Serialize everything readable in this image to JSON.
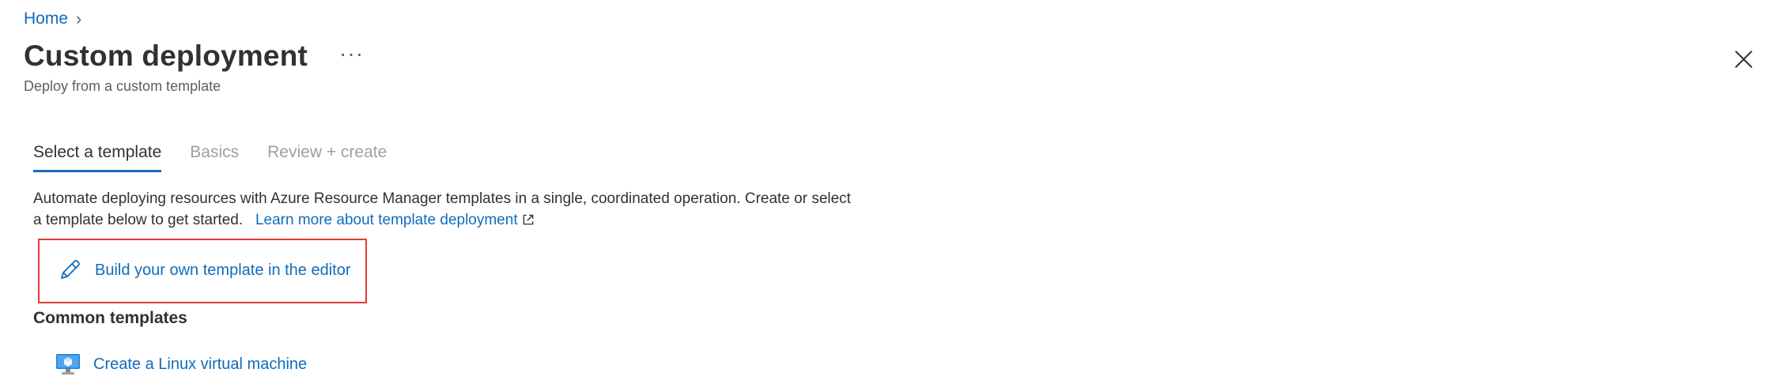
{
  "breadcrumb": {
    "home": "Home",
    "separator": "›"
  },
  "header": {
    "title": "Custom deployment",
    "more": "···",
    "subtitle": "Deploy from a custom template"
  },
  "tabs": [
    {
      "label": "Select a template",
      "active": true
    },
    {
      "label": "Basics",
      "active": false
    },
    {
      "label": "Review + create",
      "active": false
    }
  ],
  "description": {
    "text": "Automate deploying resources with Azure Resource Manager templates in a single, coordinated operation. Create or select a template below to get started.",
    "link": "Learn more about template deployment"
  },
  "build": {
    "label": "Build your own template in the editor"
  },
  "common_templates": {
    "title": "Common templates",
    "items": [
      {
        "label": "Create a Linux virtual machine"
      }
    ]
  },
  "colors": {
    "accent": "#0f6cbd",
    "highlight": "#e53935"
  }
}
